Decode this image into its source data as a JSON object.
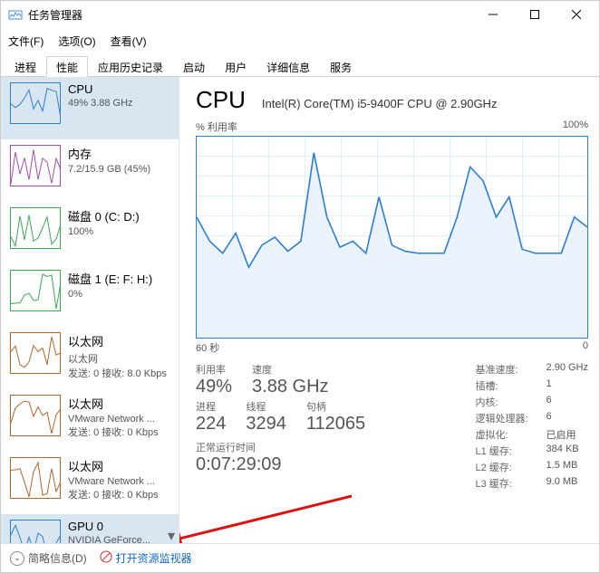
{
  "window": {
    "title": "任务管理器",
    "min": "—",
    "max": "☐",
    "close": "✕"
  },
  "menu": {
    "file": "文件(F)",
    "options": "选项(O)",
    "view": "查看(V)"
  },
  "tabs": [
    "进程",
    "性能",
    "应用历史记录",
    "启动",
    "用户",
    "详细信息",
    "服务"
  ],
  "active_tab": 1,
  "sidebar": [
    {
      "title": "CPU",
      "sub": "49% 3.88 GHz",
      "color": "#2d7dd2",
      "selected": true
    },
    {
      "title": "内存",
      "sub": "7.2/15.9 GB (45%)",
      "color": "#a84caa",
      "selected": false
    },
    {
      "title": "磁盘 0 (C: D:)",
      "sub": "100%",
      "color": "#3aa757",
      "selected": false
    },
    {
      "title": "磁盘 1 (E: F: H:)",
      "sub": "0%",
      "color": "#3aa757",
      "selected": false
    },
    {
      "title": "以太网",
      "sub": "以太网\n发送: 0 接收: 8.0 Kbps",
      "color": "#b56427",
      "selected": false
    },
    {
      "title": "以太网",
      "sub": "VMware Network ...\n发送: 0 接收: 0 Kbps",
      "color": "#b56427",
      "selected": false
    },
    {
      "title": "以太网",
      "sub": "VMware Network ...\n发送: 0 接收: 0 Kbps",
      "color": "#b56427",
      "selected": false
    },
    {
      "title": "GPU 0",
      "sub": "NVIDIA GeForce...",
      "color": "#2d7dd2",
      "selected": true
    }
  ],
  "detail": {
    "title": "CPU",
    "subtitle": "Intel(R) Core(TM) i5-9400F CPU @ 2.90GHz",
    "chart_ylabel": "% 利用率",
    "chart_ymax": "100%",
    "chart_xleft": "60 秒",
    "chart_xright": "0"
  },
  "chart_data": {
    "type": "area",
    "title": "% 利用率",
    "xlabel": "60 秒 → 0",
    "ylabel": "% 利用率",
    "ylim": [
      0,
      100
    ],
    "x_seconds": [
      60,
      58,
      56,
      54,
      52,
      50,
      48,
      46,
      44,
      42,
      40,
      38,
      36,
      34,
      32,
      30,
      28,
      26,
      24,
      22,
      20,
      18,
      16,
      14,
      12,
      10,
      8,
      6,
      4,
      2,
      0
    ],
    "values": [
      60,
      48,
      42,
      52,
      35,
      46,
      50,
      43,
      48,
      92,
      60,
      45,
      48,
      42,
      70,
      46,
      43,
      42,
      42,
      42,
      60,
      85,
      78,
      60,
      70,
      44,
      42,
      42,
      42,
      60,
      55
    ]
  },
  "stats_left": {
    "util_label": "利用率",
    "util_value": "49%",
    "speed_label": "速度",
    "speed_value": "3.88 GHz",
    "proc_label": "进程",
    "proc_value": "224",
    "thread_label": "线程",
    "thread_value": "3294",
    "handle_label": "句柄",
    "handle_value": "112065",
    "uptime_label": "正常运行时间",
    "uptime_value": "0:07:29:09"
  },
  "stats_right": [
    {
      "lbl": "基准速度:",
      "val": "2.90 GHz"
    },
    {
      "lbl": "插槽:",
      "val": "1"
    },
    {
      "lbl": "内核:",
      "val": "6"
    },
    {
      "lbl": "逻辑处理器:",
      "val": "6"
    },
    {
      "lbl": "虚拟化:",
      "val": "已启用"
    },
    {
      "lbl": "L1 缓存:",
      "val": "384 KB"
    },
    {
      "lbl": "L2 缓存:",
      "val": "1.5 MB"
    },
    {
      "lbl": "L3 缓存:",
      "val": "9.0 MB"
    }
  ],
  "bottom": {
    "fewer": "简略信息(D)",
    "resmon": "打开资源监视器"
  }
}
